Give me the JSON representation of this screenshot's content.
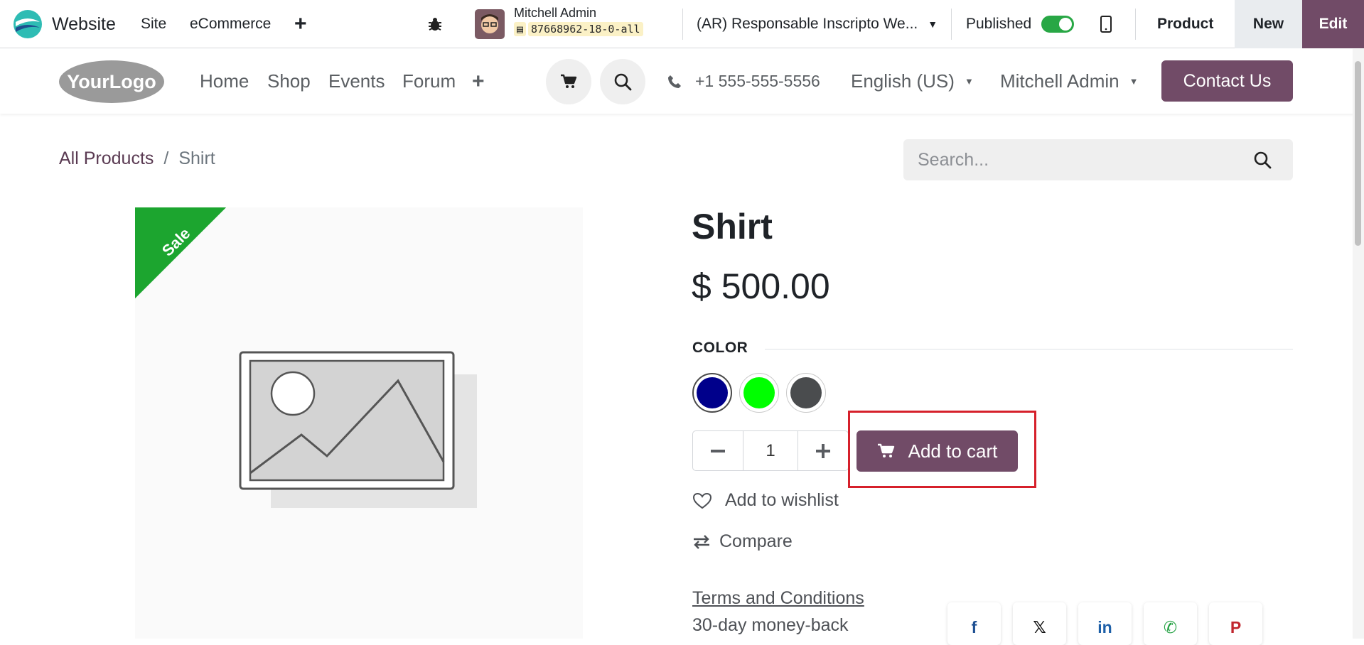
{
  "topbar": {
    "app_name": "Website",
    "menus": [
      "Site",
      "eCommerce"
    ],
    "user_name": "Mitchell Admin",
    "db_name": "87668962-18-0-all",
    "website_selector": "(AR) Responsable Inscripto We...",
    "published_label": "Published",
    "product_label": "Product",
    "new_label": "New",
    "edit_label": "Edit"
  },
  "header": {
    "logo_text": "YourLogo",
    "nav": [
      "Home",
      "Shop",
      "Events",
      "Forum"
    ],
    "phone": "+1 555-555-5556",
    "language": "English (US)",
    "user": "Mitchell Admin",
    "contact_button": "Contact Us"
  },
  "breadcrumb": {
    "parent": "All Products",
    "separator": "/",
    "current": "Shirt"
  },
  "search": {
    "placeholder": "Search..."
  },
  "product": {
    "ribbon": "Sale",
    "name": "Shirt",
    "price": "$ 500.00",
    "attribute_label": "COLOR",
    "colors": [
      {
        "name": "Navy",
        "hex": "#00008b",
        "selected": true
      },
      {
        "name": "Green",
        "hex": "#00ff00",
        "selected": false
      },
      {
        "name": "Dark Grey",
        "hex": "#4a4c4e",
        "selected": false
      }
    ],
    "quantity": "1",
    "add_to_cart": "Add to cart",
    "wishlist": "Add to wishlist",
    "compare": "Compare",
    "terms": "Terms and Conditions",
    "guarantee": "30-day money-back"
  },
  "share_icons": [
    "facebook-icon",
    "x-icon",
    "linkedin-icon",
    "whatsapp-icon",
    "pinterest-icon"
  ],
  "colors": {
    "brand": "#714b67",
    "sale": "#1ca52f",
    "highlight": "#d6202b"
  }
}
